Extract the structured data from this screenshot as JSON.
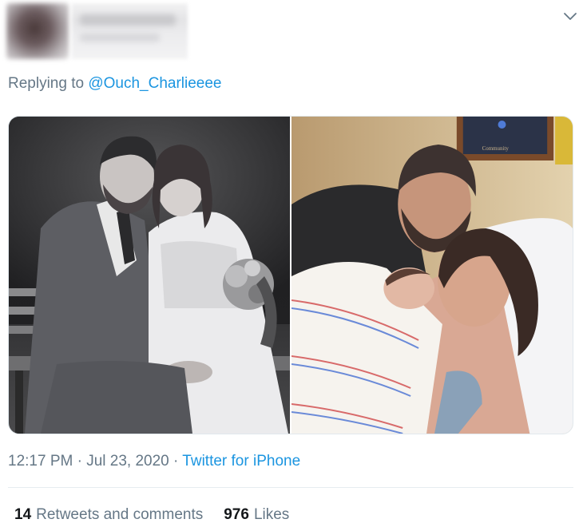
{
  "header": {
    "caret_icon": "chevron-down-icon"
  },
  "reply": {
    "prefix": "Replying to",
    "mention": "@Ouch_Charlieeee"
  },
  "media": {
    "photo_count": 2
  },
  "meta": {
    "time": "12:17 PM",
    "sep1": "·",
    "date": "Jul 23, 2020",
    "sep2": "·",
    "source": "Twitter for iPhone"
  },
  "stats": {
    "retweets_count": "14",
    "retweets_label": "Retweets and comments",
    "likes_count": "976",
    "likes_label": "Likes"
  },
  "colors": {
    "link": "#1b95e0",
    "muted": "#657786",
    "text": "#14171a"
  }
}
